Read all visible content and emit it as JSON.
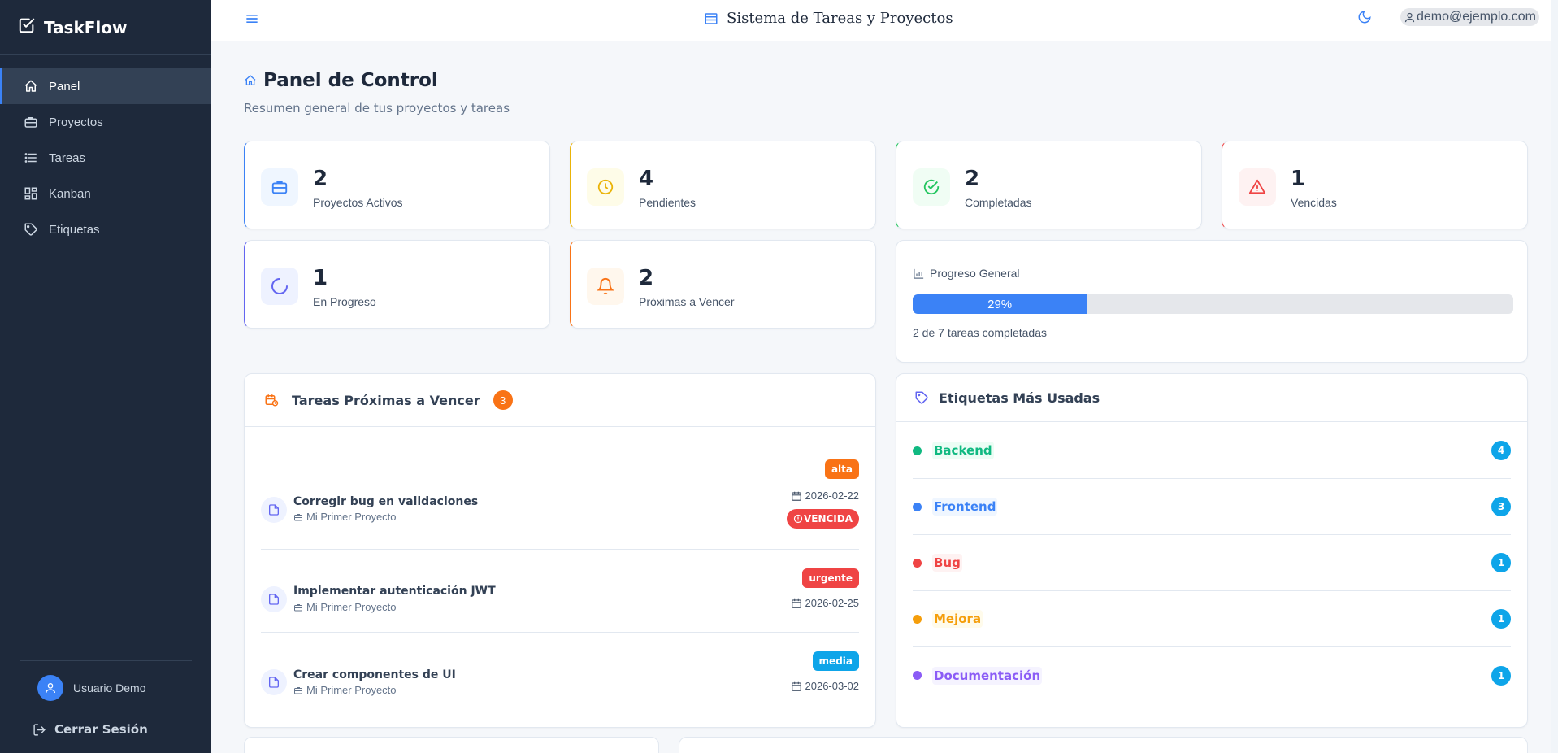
{
  "app": {
    "brand": "TaskFlow",
    "title": "Sistema de Tareas y Proyectos",
    "user_email": "demo@ejemplo.com"
  },
  "sidebar": {
    "items": [
      {
        "label": "Panel",
        "icon": "home-icon",
        "active": true
      },
      {
        "label": "Proyectos",
        "icon": "briefcase-icon"
      },
      {
        "label": "Tareas",
        "icon": "list-icon"
      },
      {
        "label": "Kanban",
        "icon": "kanban-icon"
      },
      {
        "label": "Etiquetas",
        "icon": "tag-icon"
      }
    ],
    "user_name": "Usuario Demo",
    "logout": "Cerrar Sesión"
  },
  "page": {
    "title": "Panel de Control",
    "subtitle": "Resumen general de tus proyectos y tareas"
  },
  "stats": [
    {
      "value": "2",
      "label": "Proyectos Activos",
      "icon": "briefcase-icon",
      "color": "#3b82f6"
    },
    {
      "value": "4",
      "label": "Pendientes",
      "icon": "clock-icon",
      "color": "#eab308"
    },
    {
      "value": "2",
      "label": "Completadas",
      "icon": "check-circle-icon",
      "color": "#22c55e"
    },
    {
      "value": "1",
      "label": "Vencidas",
      "icon": "warning-icon",
      "color": "#ef4444"
    },
    {
      "value": "1",
      "label": "En Progreso",
      "icon": "spinner-icon",
      "color": "#6366f1"
    },
    {
      "value": "2",
      "label": "Próximas a Vencer",
      "icon": "bell-icon",
      "color": "#f97316"
    }
  ],
  "progress": {
    "title": "Progreso General",
    "percent_label": "29%",
    "percent": 29,
    "summary": "2 de 7 tareas completadas"
  },
  "upcoming": {
    "title": "Tareas Próximas a Vencer",
    "count": "3",
    "tasks": [
      {
        "name": "Corregir bug en validaciones",
        "project": "Mi Primer Proyecto",
        "priority": "alta",
        "priority_color": "#f97316",
        "date": "2026-02-22",
        "overdue": "VENCIDA"
      },
      {
        "name": "Implementar autenticación JWT",
        "project": "Mi Primer Proyecto",
        "priority": "urgente",
        "priority_color": "#ef4444",
        "date": "2026-02-25"
      },
      {
        "name": "Crear componentes de UI",
        "project": "Mi Primer Proyecto",
        "priority": "media",
        "priority_color": "#0ea5e9",
        "date": "2026-03-02"
      }
    ]
  },
  "tags": {
    "title": "Etiquetas Más Usadas",
    "items": [
      {
        "name": "Backend",
        "count": "4",
        "color": "#10b981",
        "bg": "#ecfdf5"
      },
      {
        "name": "Frontend",
        "count": "3",
        "color": "#3b82f6",
        "bg": "#eff6ff"
      },
      {
        "name": "Bug",
        "count": "1",
        "color": "#ef4444",
        "bg": "#fef2f2"
      },
      {
        "name": "Mejora",
        "count": "1",
        "color": "#f59e0b",
        "bg": "#fffbeb"
      },
      {
        "name": "Documentación",
        "count": "1",
        "color": "#8b5cf6",
        "bg": "#f5f3ff"
      }
    ]
  }
}
